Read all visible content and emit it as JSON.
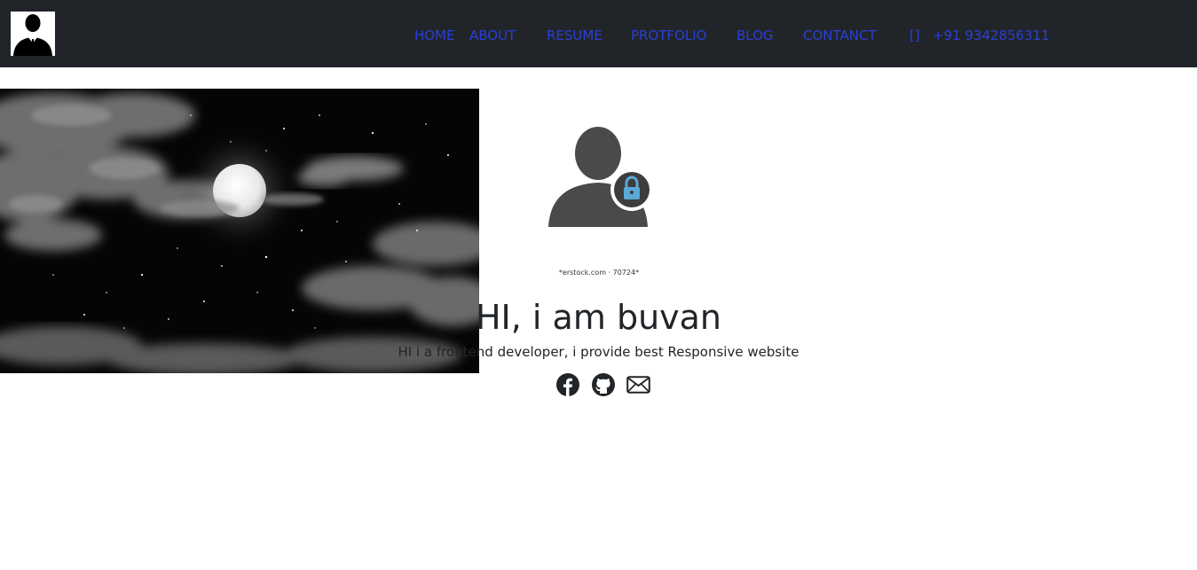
{
  "navbar": {
    "logo_icon": "businessman-silhouette-icon",
    "links": [
      {
        "label": "HOME"
      },
      {
        "label": "ABOUT"
      },
      {
        "label": "RESUME"
      },
      {
        "label": "PROTFOLIO"
      },
      {
        "label": "BLOG"
      },
      {
        "label": "CONTANCT"
      },
      {
        "label": "[]"
      },
      {
        "label": "+91 9342856311"
      }
    ],
    "link_color": "#2a3fd6",
    "background": "#212529"
  },
  "hero": {
    "background_image": "night-sky-moon-clouds",
    "avatar_icon": "user-lock-icon",
    "image_caption": "*erstock.com · 70724*",
    "title": "HI, i am buvan",
    "subtitle": "HI i a frontend developer, i provide best Responsive website",
    "socials": [
      {
        "icon": "facebook-icon"
      },
      {
        "icon": "github-icon"
      },
      {
        "icon": "envelope-icon"
      }
    ]
  }
}
